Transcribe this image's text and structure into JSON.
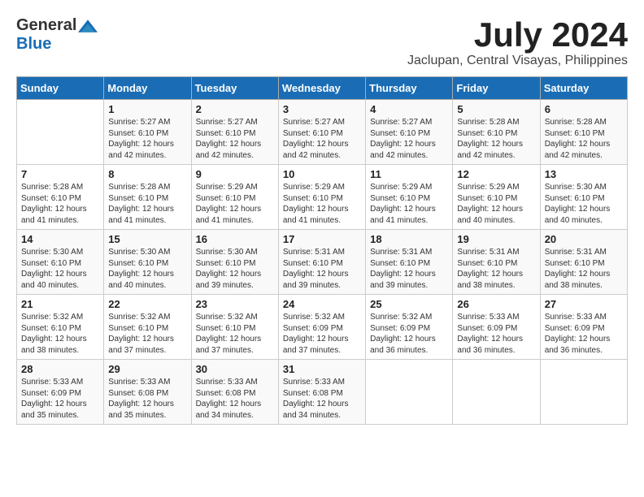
{
  "logo": {
    "general": "General",
    "blue": "Blue"
  },
  "title": {
    "month": "July 2024",
    "location": "Jaclupan, Central Visayas, Philippines"
  },
  "weekdays": [
    "Sunday",
    "Monday",
    "Tuesday",
    "Wednesday",
    "Thursday",
    "Friday",
    "Saturday"
  ],
  "weeks": [
    [
      {
        "day": "",
        "info": ""
      },
      {
        "day": "1",
        "info": "Sunrise: 5:27 AM\nSunset: 6:10 PM\nDaylight: 12 hours\nand 42 minutes."
      },
      {
        "day": "2",
        "info": "Sunrise: 5:27 AM\nSunset: 6:10 PM\nDaylight: 12 hours\nand 42 minutes."
      },
      {
        "day": "3",
        "info": "Sunrise: 5:27 AM\nSunset: 6:10 PM\nDaylight: 12 hours\nand 42 minutes."
      },
      {
        "day": "4",
        "info": "Sunrise: 5:27 AM\nSunset: 6:10 PM\nDaylight: 12 hours\nand 42 minutes."
      },
      {
        "day": "5",
        "info": "Sunrise: 5:28 AM\nSunset: 6:10 PM\nDaylight: 12 hours\nand 42 minutes."
      },
      {
        "day": "6",
        "info": "Sunrise: 5:28 AM\nSunset: 6:10 PM\nDaylight: 12 hours\nand 42 minutes."
      }
    ],
    [
      {
        "day": "7",
        "info": "Sunrise: 5:28 AM\nSunset: 6:10 PM\nDaylight: 12 hours\nand 41 minutes."
      },
      {
        "day": "8",
        "info": "Sunrise: 5:28 AM\nSunset: 6:10 PM\nDaylight: 12 hours\nand 41 minutes."
      },
      {
        "day": "9",
        "info": "Sunrise: 5:29 AM\nSunset: 6:10 PM\nDaylight: 12 hours\nand 41 minutes."
      },
      {
        "day": "10",
        "info": "Sunrise: 5:29 AM\nSunset: 6:10 PM\nDaylight: 12 hours\nand 41 minutes."
      },
      {
        "day": "11",
        "info": "Sunrise: 5:29 AM\nSunset: 6:10 PM\nDaylight: 12 hours\nand 41 minutes."
      },
      {
        "day": "12",
        "info": "Sunrise: 5:29 AM\nSunset: 6:10 PM\nDaylight: 12 hours\nand 40 minutes."
      },
      {
        "day": "13",
        "info": "Sunrise: 5:30 AM\nSunset: 6:10 PM\nDaylight: 12 hours\nand 40 minutes."
      }
    ],
    [
      {
        "day": "14",
        "info": "Sunrise: 5:30 AM\nSunset: 6:10 PM\nDaylight: 12 hours\nand 40 minutes."
      },
      {
        "day": "15",
        "info": "Sunrise: 5:30 AM\nSunset: 6:10 PM\nDaylight: 12 hours\nand 40 minutes."
      },
      {
        "day": "16",
        "info": "Sunrise: 5:30 AM\nSunset: 6:10 PM\nDaylight: 12 hours\nand 39 minutes."
      },
      {
        "day": "17",
        "info": "Sunrise: 5:31 AM\nSunset: 6:10 PM\nDaylight: 12 hours\nand 39 minutes."
      },
      {
        "day": "18",
        "info": "Sunrise: 5:31 AM\nSunset: 6:10 PM\nDaylight: 12 hours\nand 39 minutes."
      },
      {
        "day": "19",
        "info": "Sunrise: 5:31 AM\nSunset: 6:10 PM\nDaylight: 12 hours\nand 38 minutes."
      },
      {
        "day": "20",
        "info": "Sunrise: 5:31 AM\nSunset: 6:10 PM\nDaylight: 12 hours\nand 38 minutes."
      }
    ],
    [
      {
        "day": "21",
        "info": "Sunrise: 5:32 AM\nSunset: 6:10 PM\nDaylight: 12 hours\nand 38 minutes."
      },
      {
        "day": "22",
        "info": "Sunrise: 5:32 AM\nSunset: 6:10 PM\nDaylight: 12 hours\nand 37 minutes."
      },
      {
        "day": "23",
        "info": "Sunrise: 5:32 AM\nSunset: 6:10 PM\nDaylight: 12 hours\nand 37 minutes."
      },
      {
        "day": "24",
        "info": "Sunrise: 5:32 AM\nSunset: 6:09 PM\nDaylight: 12 hours\nand 37 minutes."
      },
      {
        "day": "25",
        "info": "Sunrise: 5:32 AM\nSunset: 6:09 PM\nDaylight: 12 hours\nand 36 minutes."
      },
      {
        "day": "26",
        "info": "Sunrise: 5:33 AM\nSunset: 6:09 PM\nDaylight: 12 hours\nand 36 minutes."
      },
      {
        "day": "27",
        "info": "Sunrise: 5:33 AM\nSunset: 6:09 PM\nDaylight: 12 hours\nand 36 minutes."
      }
    ],
    [
      {
        "day": "28",
        "info": "Sunrise: 5:33 AM\nSunset: 6:09 PM\nDaylight: 12 hours\nand 35 minutes."
      },
      {
        "day": "29",
        "info": "Sunrise: 5:33 AM\nSunset: 6:08 PM\nDaylight: 12 hours\nand 35 minutes."
      },
      {
        "day": "30",
        "info": "Sunrise: 5:33 AM\nSunset: 6:08 PM\nDaylight: 12 hours\nand 34 minutes."
      },
      {
        "day": "31",
        "info": "Sunrise: 5:33 AM\nSunset: 6:08 PM\nDaylight: 12 hours\nand 34 minutes."
      },
      {
        "day": "",
        "info": ""
      },
      {
        "day": "",
        "info": ""
      },
      {
        "day": "",
        "info": ""
      }
    ]
  ]
}
